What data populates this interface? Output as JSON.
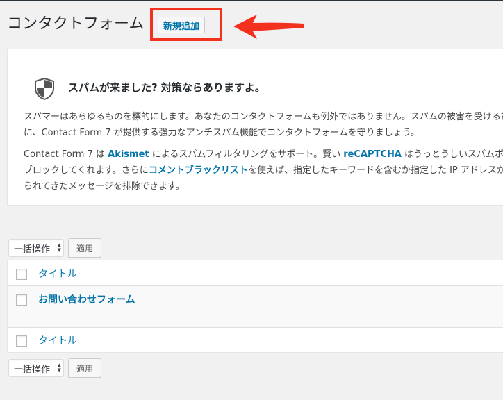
{
  "header": {
    "title": "コンタクトフォーム",
    "add_new_label": "新規追加"
  },
  "notice": {
    "heading": "スパムが来ました? 対策ならありますよ。",
    "para1": {
      "line1": "スパマーはあらゆるものを標的にします。あなたのコンタクトフォームも例外ではありません。スパムの被害を受ける前",
      "line2": "に、Contact Form 7 が提供する強力なアンチスパム機能でコンタクトフォームを守りましょう。"
    },
    "para2": {
      "l1_a": "Contact Form 7 は ",
      "l1_link1": "Akismet",
      "l1_b": " によるスパムフィルタリングをサポート。賢い ",
      "l1_link2": "reCAPTCHA",
      "l1_c": " はうっとうしいスパムボッ",
      "l2_a": "ブロックしてくれます。さらに",
      "l2_link": "コメントブラックリスト",
      "l2_b": "を使えば、指定したキーワードを含むか指定した IP アドレスか",
      "l3": "られてきたメッセージを排除できます。"
    }
  },
  "bulk_top": {
    "select_label": "一括操作",
    "apply_label": "適用"
  },
  "bulk_bottom": {
    "select_label": "一括操作",
    "apply_label": "適用"
  },
  "table": {
    "header_title": "タイトル",
    "rows": [
      {
        "title": "お問い合わせフォーム"
      }
    ],
    "footer_title": "タイトル"
  },
  "colors": {
    "highlight": "#f2321e",
    "link": "#0073aa"
  },
  "icons": {
    "shield": "shield-icon",
    "arrow": "arrow-icon"
  }
}
